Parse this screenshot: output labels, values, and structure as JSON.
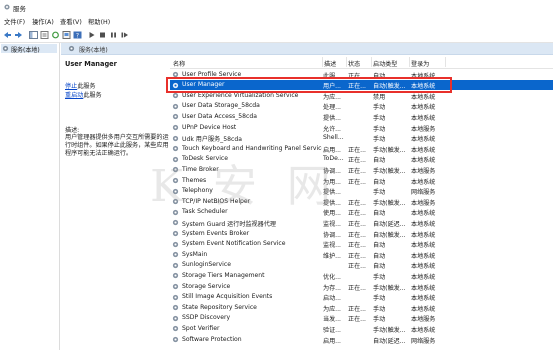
{
  "window": {
    "title": "服务"
  },
  "menu": [
    "文件(F)",
    "操作(A)",
    "查看(V)",
    "帮助(H)"
  ],
  "tree": {
    "root_label": "服务(本地)"
  },
  "main": {
    "header_label": "服务(本地)",
    "selected_service": "User Manager",
    "stop_link": "停止",
    "stop_suffix": "此服务",
    "restart_link": "重启动",
    "restart_suffix": "此服务",
    "description_label": "描述:",
    "description_text": "用户管理器提供多用户交互所需要的运行时组件。如果停止此服务，某些应用程序可能无法正确运行。"
  },
  "columns": [
    "名称",
    "描述",
    "状态",
    "启动类型",
    "登录为"
  ],
  "rows": [
    {
      "name": "User Profile Service",
      "desc": "此服...",
      "status": "正在...",
      "start": "自动",
      "login": "本地系统"
    },
    {
      "name": "User Manager",
      "desc": "用户...",
      "status": "正在...",
      "start": "自动(触发...",
      "login": "本地系统",
      "selected": true
    },
    {
      "name": "User Experience Virtualization Service",
      "desc": "为应...",
      "status": "",
      "start": "禁用",
      "login": "本地系统"
    },
    {
      "name": "User Data Storage_58cda",
      "desc": "处理...",
      "status": "",
      "start": "手动",
      "login": "本地系统"
    },
    {
      "name": "User Data Access_58cda",
      "desc": "提供...",
      "status": "",
      "start": "手动",
      "login": "本地系统"
    },
    {
      "name": "UPnP Device Host",
      "desc": "允许...",
      "status": "",
      "start": "手动",
      "login": "本地服务"
    },
    {
      "name": "Udk 用户服务_58cda",
      "desc": "Shell...",
      "status": "",
      "start": "手动",
      "login": "本地系统"
    },
    {
      "name": "Touch Keyboard and Handwriting Panel Service",
      "desc": "启用...",
      "status": "正在...",
      "start": "手动(触发...",
      "login": "本地系统"
    },
    {
      "name": "ToDesk Service",
      "desc": "ToDe...",
      "status": "正在...",
      "start": "自动",
      "login": "本地系统"
    },
    {
      "name": "Time Broker",
      "desc": "协调...",
      "status": "正在...",
      "start": "手动(触发...",
      "login": "本地服务"
    },
    {
      "name": "Themes",
      "desc": "为用...",
      "status": "正在...",
      "start": "自动",
      "login": "本地系统"
    },
    {
      "name": "Telephony",
      "desc": "提供...",
      "status": "",
      "start": "手动",
      "login": "网络服务"
    },
    {
      "name": "TCP/IP NetBIOS Helper",
      "desc": "提供...",
      "status": "正在...",
      "start": "手动(触发...",
      "login": "本地服务"
    },
    {
      "name": "Task Scheduler",
      "desc": "使用...",
      "status": "正在...",
      "start": "自动",
      "login": "本地系统"
    },
    {
      "name": "System Guard 运行时监视器代理",
      "desc": "监视...",
      "status": "正在...",
      "start": "自动(延迟...",
      "login": "本地系统"
    },
    {
      "name": "System Events Broker",
      "desc": "协调...",
      "status": "正在...",
      "start": "自动(触发...",
      "login": "本地系统"
    },
    {
      "name": "System Event Notification Service",
      "desc": "监视...",
      "status": "正在...",
      "start": "自动",
      "login": "本地系统"
    },
    {
      "name": "SysMain",
      "desc": "维护...",
      "status": "正在...",
      "start": "自动",
      "login": "本地系统"
    },
    {
      "name": "SunloginService",
      "desc": "",
      "status": "正在...",
      "start": "自动",
      "login": "本地系统"
    },
    {
      "name": "Storage Tiers Management",
      "desc": "优化...",
      "status": "",
      "start": "手动",
      "login": "本地系统"
    },
    {
      "name": "Storage Service",
      "desc": "为存...",
      "status": "正在...",
      "start": "手动(触发...",
      "login": "本地系统"
    },
    {
      "name": "Still Image Acquisition Events",
      "desc": "启动...",
      "status": "",
      "start": "手动",
      "login": "本地系统"
    },
    {
      "name": "State Repository Service",
      "desc": "为应...",
      "status": "正在...",
      "start": "手动",
      "login": "本地系统"
    },
    {
      "name": "SSDP Discovery",
      "desc": "当发...",
      "status": "正在...",
      "start": "手动",
      "login": "本地服务"
    },
    {
      "name": "Spot Verifier",
      "desc": "验证...",
      "status": "",
      "start": "手动(触发...",
      "login": "本地系统"
    },
    {
      "name": "Software Protection",
      "desc": "启用...",
      "status": "",
      "start": "自动(延迟...",
      "login": "网络服务"
    }
  ],
  "watermark": "K 安 网"
}
